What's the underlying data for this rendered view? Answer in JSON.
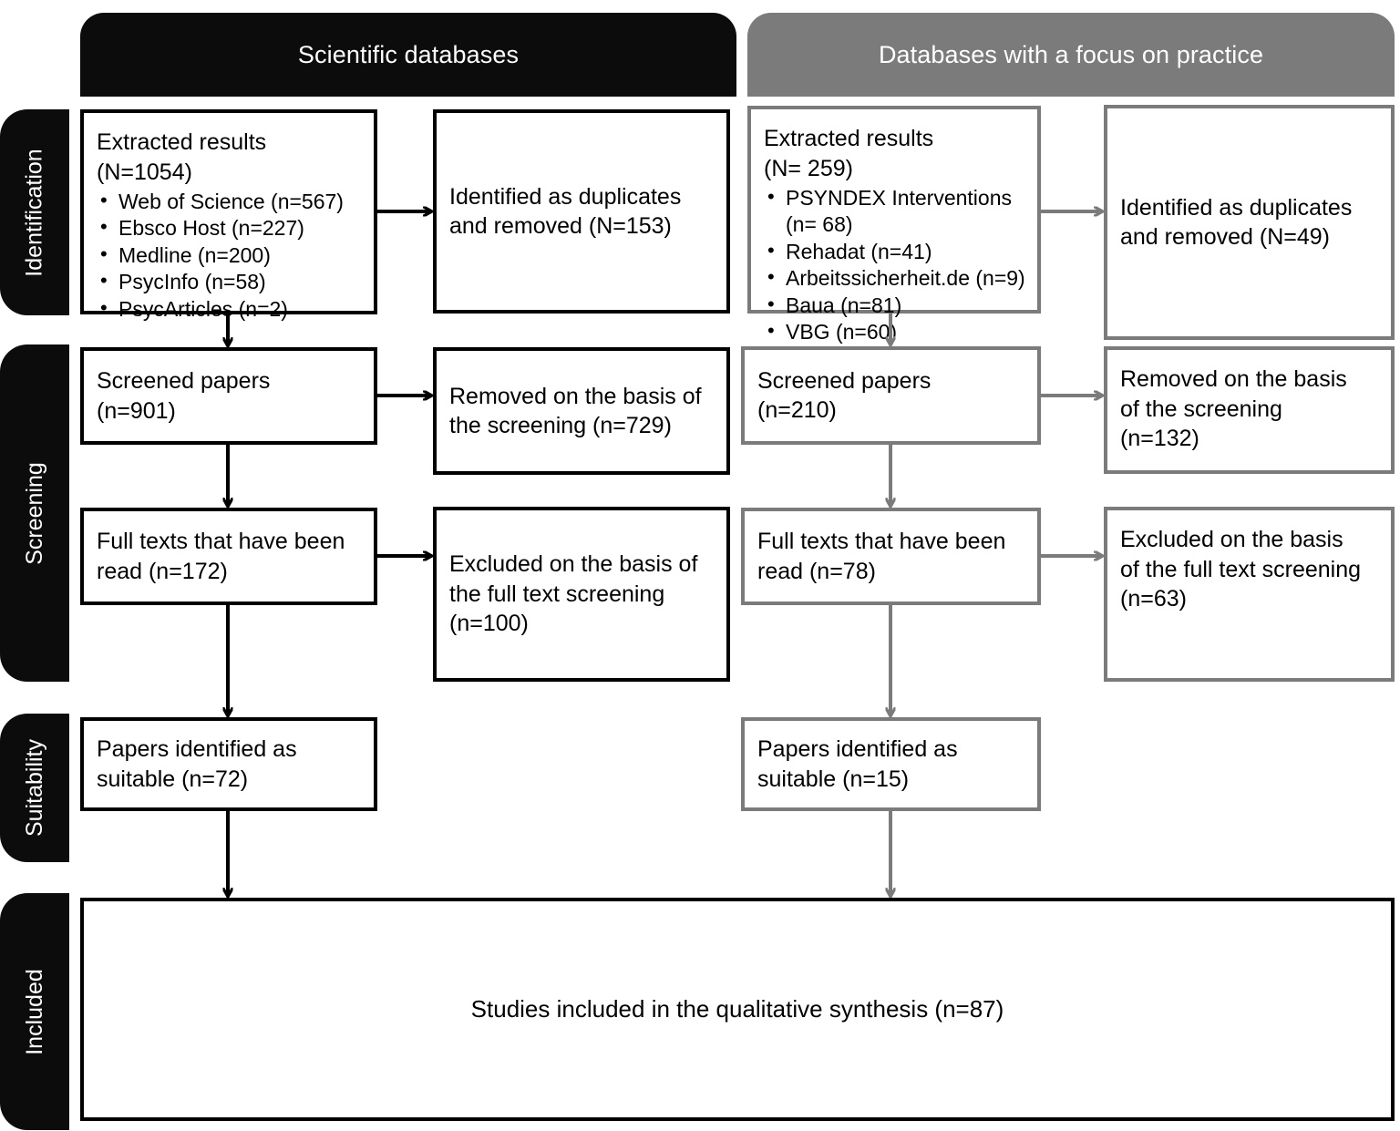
{
  "diagram": {
    "type": "PRISMA flow diagram",
    "columns": [
      {
        "id": "scientific",
        "label": "Scientific databases",
        "color": "#0c0c0c"
      },
      {
        "id": "practice",
        "label": "Databases with a focus on practice",
        "color": "#7b7b7b"
      }
    ],
    "stages": [
      {
        "id": "identification",
        "label": "Identification"
      },
      {
        "id": "screening",
        "label": "Screening"
      },
      {
        "id": "suitability",
        "label": "Suitability"
      },
      {
        "id": "included",
        "label": "Included"
      }
    ],
    "left": {
      "extracted": {
        "title": "Extracted results",
        "total": "(N=1054)",
        "sources": [
          "Web of Science (n=567)",
          "Ebsco Host (n=227)",
          "Medline (n=200)",
          "PsycInfo (n=58)",
          "PsycArticles (n=2)"
        ]
      },
      "duplicates": "Identified as duplicates\nand removed (N=153)",
      "screened": "Screened papers\n(n=901)",
      "removed_screening": "Removed on the basis of\nthe screening (n=729)",
      "full_texts": "Full texts that have been\nread (n=172)",
      "excluded_fulltext": "Excluded on the basis of\nthe full text screening\n(n=100)",
      "suitable": "Papers identified as\nsuitable (n=72)"
    },
    "right": {
      "extracted": {
        "title": "Extracted results",
        "total": "(N= 259)",
        "sources": [
          "PSYNDEX Interventions\n(n= 68)",
          "Rehadat (n=41)",
          "Arbeitssicherheit.de (n=9)",
          "Baua (n=81)",
          "VBG (n=60)"
        ]
      },
      "duplicates": "Identified as duplicates\nand removed (N=49)",
      "screened": "Screened papers\n(n=210)",
      "removed_screening": "Removed on the basis\nof the screening\n(n=132)",
      "full_texts": "Full texts that have been\nread (n=78)",
      "excluded_fulltext": "Excluded on the basis\nof the full text screening\n(n=63)",
      "suitable": "Papers identified as\nsuitable (n=15)"
    },
    "included_box": "Studies included in the qualitative synthesis (n=87)"
  }
}
